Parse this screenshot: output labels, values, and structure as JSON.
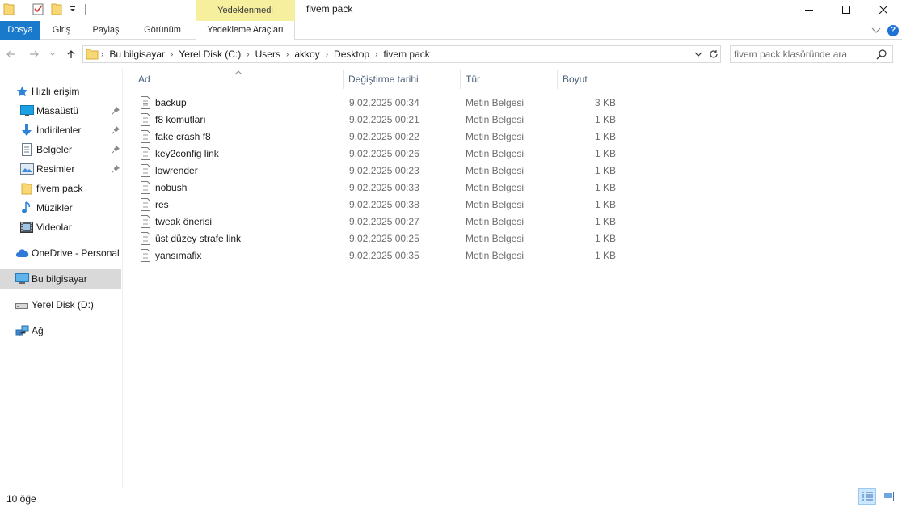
{
  "window": {
    "title": "fivem pack",
    "context_label": "Yedeklenmedi",
    "controls": [
      "minimize",
      "maximize",
      "close"
    ]
  },
  "ribbon": {
    "tabs": [
      {
        "label": "Dosya",
        "active": true
      },
      {
        "label": "Giriş"
      },
      {
        "label": "Paylaş"
      },
      {
        "label": "Görünüm"
      },
      {
        "label": "Yedekleme Araçları"
      }
    ]
  },
  "address": {
    "breadcrumbs": [
      "Bu bilgisayar",
      "Yerel Disk (C:)",
      "Users",
      "akkoy",
      "Desktop",
      "fivem pack"
    ]
  },
  "search": {
    "placeholder": "fivem pack klasöründe ara"
  },
  "sidebar": {
    "quick_access": {
      "label": "Hızlı erişim",
      "icon": "star-icon"
    },
    "items": [
      {
        "label": "Masaüstü",
        "icon": "desktop-icon",
        "pinned": true
      },
      {
        "label": "İndirilenler",
        "icon": "download-icon",
        "pinned": true
      },
      {
        "label": "Belgeler",
        "icon": "documents-icon",
        "pinned": true
      },
      {
        "label": "Resimler",
        "icon": "pictures-icon",
        "pinned": true
      },
      {
        "label": "fivem pack",
        "icon": "folder-icon",
        "pinned": false
      },
      {
        "label": "Müzikler",
        "icon": "music-icon",
        "pinned": false
      },
      {
        "label": "Videolar",
        "icon": "video-icon",
        "pinned": false
      }
    ],
    "onedrive": {
      "label": "OneDrive - Personal",
      "icon": "cloud-icon"
    },
    "this_pc": {
      "label": "Bu bilgisayar",
      "icon": "computer-icon",
      "selected": true
    },
    "disk_d": {
      "label": "Yerel Disk (D:)",
      "icon": "drive-icon"
    },
    "network": {
      "label": "Ağ",
      "icon": "network-icon"
    }
  },
  "columns": {
    "name": "Ad",
    "date": "Değiştirme tarihi",
    "type": "Tür",
    "size": "Boyut"
  },
  "files": [
    {
      "name": "backup",
      "date": "9.02.2025 00:34",
      "type": "Metin Belgesi",
      "size": "3 KB"
    },
    {
      "name": "f8 komutları",
      "date": "9.02.2025 00:21",
      "type": "Metin Belgesi",
      "size": "1 KB"
    },
    {
      "name": "fake crash f8",
      "date": "9.02.2025 00:22",
      "type": "Metin Belgesi",
      "size": "1 KB"
    },
    {
      "name": "key2config link",
      "date": "9.02.2025 00:26",
      "type": "Metin Belgesi",
      "size": "1 KB"
    },
    {
      "name": "lowrender",
      "date": "9.02.2025 00:23",
      "type": "Metin Belgesi",
      "size": "1 KB"
    },
    {
      "name": "nobush",
      "date": "9.02.2025 00:33",
      "type": "Metin Belgesi",
      "size": "1 KB"
    },
    {
      "name": "res",
      "date": "9.02.2025 00:38",
      "type": "Metin Belgesi",
      "size": "1 KB"
    },
    {
      "name": "tweak önerisi",
      "date": "9.02.2025 00:27",
      "type": "Metin Belgesi",
      "size": "1 KB"
    },
    {
      "name": "üst düzey strafe link",
      "date": "9.02.2025 00:25",
      "type": "Metin Belgesi",
      "size": "1 KB"
    },
    {
      "name": "yansımafix",
      "date": "9.02.2025 00:35",
      "type": "Metin Belgesi",
      "size": "1 KB"
    }
  ],
  "status": {
    "item_count": "10 öğe"
  },
  "colors": {
    "accent": "#1979ca",
    "context_tab": "#f6ef9e",
    "selection": "#d9d9d9",
    "header_text": "#4c607a"
  }
}
